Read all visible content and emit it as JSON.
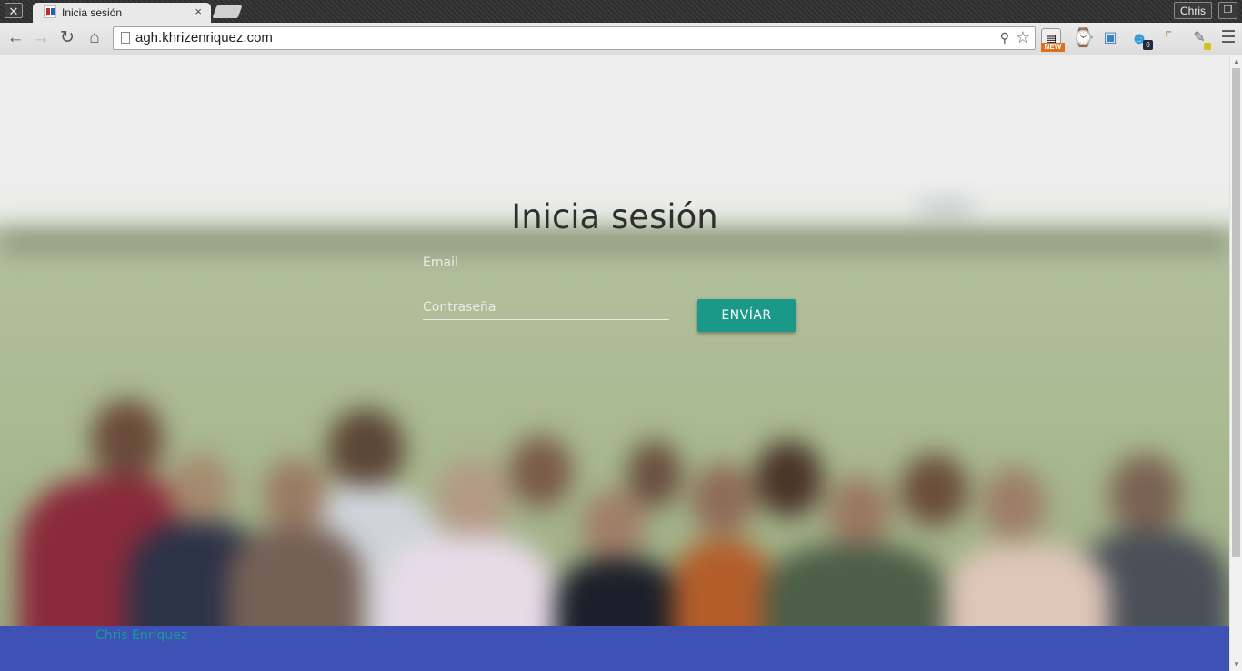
{
  "browser": {
    "tab_title": "Inicia sesión",
    "tab_close": "×",
    "window_close": "✕",
    "profile_name": "Chris",
    "restore_glyph": "❐",
    "url": "agh.khrizenriquez.com",
    "extensions": {
      "new_badge": "NEW",
      "face_count": "0"
    }
  },
  "login": {
    "title": "Inicia sesión",
    "email_placeholder": "Email",
    "password_placeholder": "Contraseña",
    "submit_label": "ENVÍAR"
  },
  "footer": {
    "author_link": "Chris Enríquez"
  },
  "colors": {
    "footer_bg": "#3e51b5",
    "button_bg": "#1a9888",
    "link": "#149e92"
  }
}
